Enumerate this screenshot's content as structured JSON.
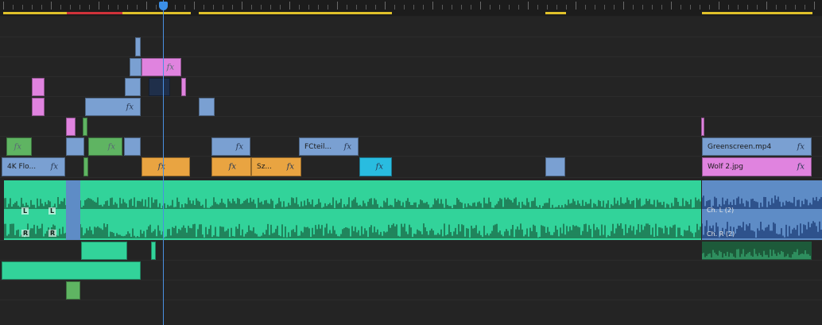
{
  "app": "Video editor timeline",
  "colors": {
    "background": "#232323",
    "playhead": "#4a90e2",
    "video_blue": "#7aa0d2",
    "video_pink": "#e083df",
    "video_orange": "#e9a441",
    "audio_green": "#32d39a"
  },
  "icons": {
    "effects": "fx-badge-icon",
    "playhead": "playhead-marker-icon"
  },
  "fx_label": "fx",
  "clips": {
    "greenscreen": "Greenscreen.mp4",
    "wolf": "Wolf 2.jpg",
    "fc_teil": "FCteil...",
    "k4_flo": "4K Flo...",
    "sz": "Sz..."
  },
  "audio": {
    "ch_left": "L",
    "ch_right": "R",
    "ch_left_2": "Ch. L (2)",
    "ch_right_2": "Ch. R (2)"
  }
}
